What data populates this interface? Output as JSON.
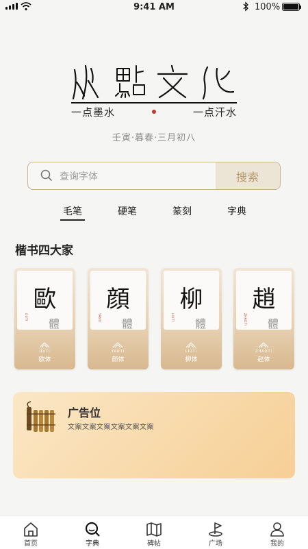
{
  "status_bar": {
    "time": "9:41 AM",
    "battery": "100%",
    "battery_level": 1.0
  },
  "logo": {
    "slogan_left": "一点墨水",
    "slogan_right": "一点汗水"
  },
  "date_text": "壬寅·暮春·三月初八",
  "search": {
    "placeholder": "查询字体",
    "button_label": "搜索"
  },
  "tabs": [
    {
      "label": "毛笔",
      "active": true
    },
    {
      "label": "硬笔",
      "active": false
    },
    {
      "label": "篆刻",
      "active": false
    },
    {
      "label": "字典",
      "active": false
    }
  ],
  "section_title": "楷书四大家",
  "cards": [
    {
      "char": "歐",
      "ti": "體",
      "pinyin": "OUTI",
      "name": "欧体"
    },
    {
      "char": "顔",
      "ti": "體",
      "pinyin": "YANTI",
      "name": "颜体"
    },
    {
      "char": "柳",
      "ti": "體",
      "pinyin": "LIUTI",
      "name": "柳体"
    },
    {
      "char": "趙",
      "ti": "體",
      "pinyin": "ZHAOTI",
      "name": "赵体"
    }
  ],
  "ad": {
    "title": "广告位",
    "text": "文案文案文案文案文案文案"
  },
  "nav": [
    {
      "label": "首页",
      "icon": "home-icon"
    },
    {
      "label": "字典",
      "icon": "search-icon",
      "active": true
    },
    {
      "label": "碑帖",
      "icon": "map-icon"
    },
    {
      "label": "广场",
      "icon": "flag-icon"
    },
    {
      "label": "我的",
      "icon": "user-icon"
    }
  ],
  "colors": {
    "accent": "#c8b48f",
    "button_bg": "#ece5d6",
    "ad_bg": "#f6cf95",
    "dot": "#c0392b"
  }
}
